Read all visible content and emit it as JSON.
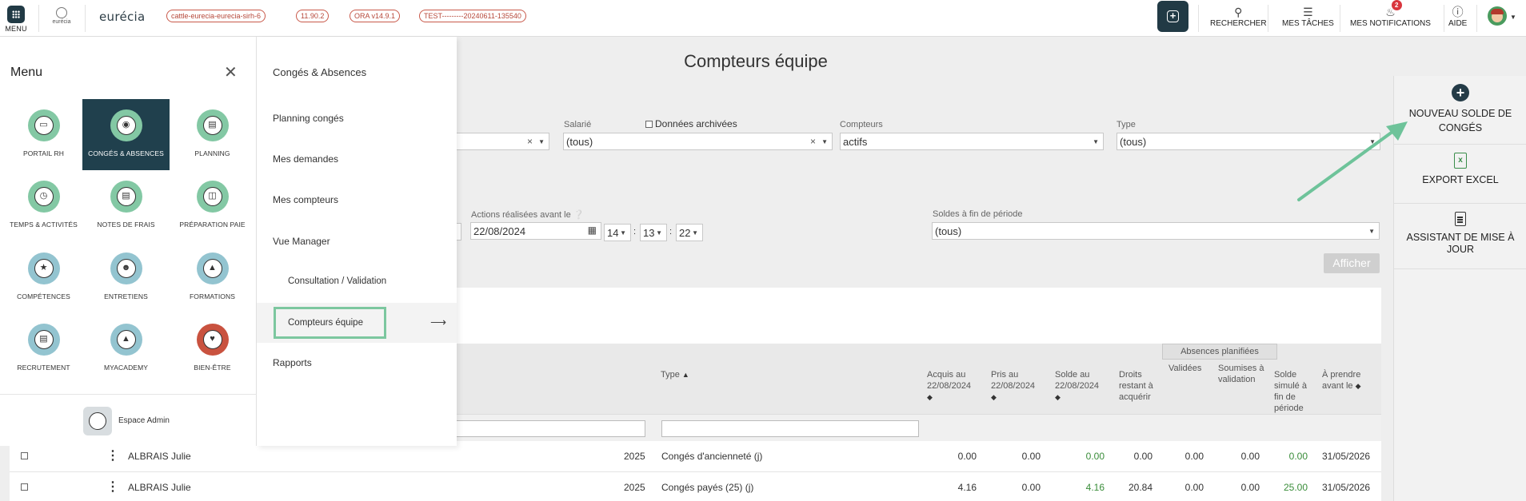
{
  "topbar": {
    "menu_label": "MENU",
    "logo_small": "eurécia",
    "brand": "eurécia",
    "tags": [
      "cattle-eurecia-eurecia-sirh-6",
      "11.90.2",
      "ORA v14.9.1",
      "TEST---------20240611-135540"
    ],
    "search_label": "RECHERCHER",
    "tasks_label": "MES TÂCHES",
    "notif_label": "MES NOTIFICATIONS",
    "notif_count": "2",
    "help_label": "AIDE"
  },
  "page": {
    "title": "Compteurs équipe"
  },
  "filters": {
    "salarie_label": "Salarié",
    "archived_label": "Données archivées",
    "salarie_value": "(tous)",
    "compteurs_label": "Compteurs",
    "compteurs_value": "actifs",
    "type_label": "Type",
    "type_value": "(tous)",
    "actions_label": "Actions réalisées avant le",
    "date_value": "22/08/2024",
    "hour": "14",
    "minute": "13",
    "second": "22",
    "soldes_label": "Soldes à fin de période",
    "soldes_value": "(tous)",
    "submit": "Afficher"
  },
  "right_panel": {
    "new_leave": "NOUVEAU SOLDE DE CONGÉS",
    "export": "EXPORT EXCEL",
    "assistant": "ASSISTANT DE MISE À JOUR"
  },
  "table": {
    "group_header": "Absences planifiées",
    "col_type": "Type",
    "col_acquis": "Acquis au 22/08/2024",
    "col_pris": "Pris au 22/08/2024",
    "col_solde": "Solde au 22/08/2024",
    "col_droits": "Droits restant à acquérir",
    "col_validees": "Validées",
    "col_soumises": "Soumises à validation",
    "col_simule": "Solde simulé à fin de période",
    "col_prendre": "À prendre avant le",
    "rows": [
      {
        "name": "ALBRAIS Julie",
        "year": "2025",
        "type": "Congés d'ancienneté (j)",
        "acquis": "0.00",
        "pris": "0.00",
        "solde": "0.00",
        "droits": "0.00",
        "validees": "0.00",
        "soumises": "0.00",
        "simule": "0.00",
        "prendre": "31/05/2026"
      },
      {
        "name": "ALBRAIS Julie",
        "year": "2025",
        "type": "Congés payés (25) (j)",
        "acquis": "4.16",
        "pris": "0.00",
        "solde": "4.16",
        "droits": "20.84",
        "validees": "0.00",
        "soumises": "0.00",
        "simule": "25.00",
        "prendre": "31/05/2026"
      }
    ]
  },
  "menu": {
    "title": "Menu",
    "modules": [
      {
        "label": "PORTAIL RH",
        "icon": "folder-icon"
      },
      {
        "label": "CONGÉS & ABSENCES",
        "icon": "flip-flops-icon"
      },
      {
        "label": "PLANNING",
        "icon": "clipboard-icon"
      },
      {
        "label": "TEMPS & ACTIVITÉS",
        "icon": "time-activity-icon"
      },
      {
        "label": "NOTES DE FRAIS",
        "icon": "receipt-icon"
      },
      {
        "label": "PRÉPARATION PAIE",
        "icon": "payroll-icon"
      },
      {
        "label": "COMPÉTENCES",
        "icon": "award-icon"
      },
      {
        "label": "ENTRETIENS",
        "icon": "interview-icon"
      },
      {
        "label": "FORMATIONS",
        "icon": "graduation-cap-icon"
      },
      {
        "label": "RECRUTEMENT",
        "icon": "cv-icon"
      },
      {
        "label": "MYACADEMY",
        "icon": "academy-icon"
      },
      {
        "label": "BIEN-ÊTRE",
        "icon": "wellbeing-icon"
      }
    ],
    "admin": "Espace Admin"
  },
  "submenu": {
    "header": "Congés & Absences",
    "items": [
      "Planning congés",
      "Mes demandes",
      "Mes compteurs",
      "Vue Manager"
    ],
    "sub_items": [
      "Consultation / Validation",
      "Compteurs équipe"
    ],
    "last": "Rapports"
  },
  "colors": {
    "dark": "#213a45",
    "accent_green": "#7cc79f",
    "value_green": "#3a8d3a",
    "tag_red": "#c9594a"
  }
}
